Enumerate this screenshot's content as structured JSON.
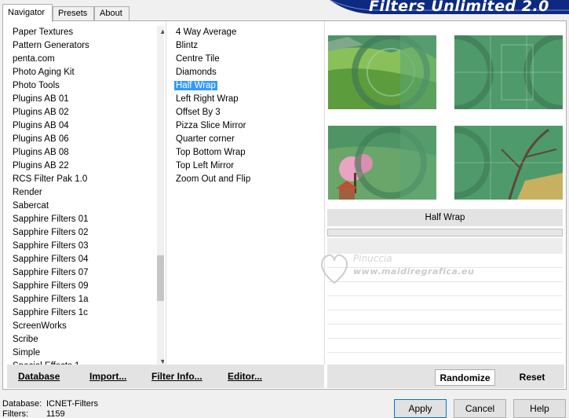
{
  "tabs": [
    "Navigator",
    "Presets",
    "About"
  ],
  "banner_title": "Filters Unlimited 2.0",
  "categories": [
    "Paper Textures",
    "Pattern Generators",
    "penta.com",
    "Photo Aging Kit",
    "Photo Tools",
    "Plugins AB 01",
    "Plugins AB 02",
    "Plugins AB 04",
    "Plugins AB 06",
    "Plugins AB 08",
    "Plugins AB 22",
    "RCS Filter Pak 1.0",
    "Render",
    "Sabercat",
    "Sapphire Filters 01",
    "Sapphire Filters 02",
    "Sapphire Filters 03",
    "Sapphire Filters 04",
    "Sapphire Filters 07",
    "Sapphire Filters 09",
    "Sapphire Filters 1a",
    "Sapphire Filters 1c",
    "ScreenWorks",
    "Scribe",
    "Simple",
    "Special Effects 1"
  ],
  "filters": [
    "4 Way Average",
    "Blintz",
    "Centre Tile",
    "Diamonds",
    "Half Wrap",
    "Left Right Wrap",
    "Offset By 3",
    "Pizza Slice Mirror",
    "Quarter corner",
    "Top Bottom Wrap",
    "Top Left Mirror",
    "Zoom Out and Flip"
  ],
  "selected_filter": "Half Wrap",
  "watermark": {
    "name": "Pinuccia",
    "url": "www.maidiregrafica.eu"
  },
  "bottom_buttons": {
    "database": "Database",
    "import": "Import...",
    "filter_info": "Filter Info...",
    "editor": "Editor..."
  },
  "right_buttons": {
    "randomize": "Randomize",
    "reset": "Reset"
  },
  "status": {
    "database_label": "Database:",
    "database_value": "ICNET-Filters",
    "filters_label": "Filters:",
    "filters_value": "1159"
  },
  "footer_buttons": {
    "apply": "Apply",
    "cancel": "Cancel",
    "help": "Help"
  },
  "colors": {
    "selection": "#3399ff",
    "banner": "#0d2a80",
    "preview_green": "#5a9e70"
  },
  "scroll_icons": {
    "up": "chevron-up-icon",
    "down": "chevron-down-icon"
  }
}
